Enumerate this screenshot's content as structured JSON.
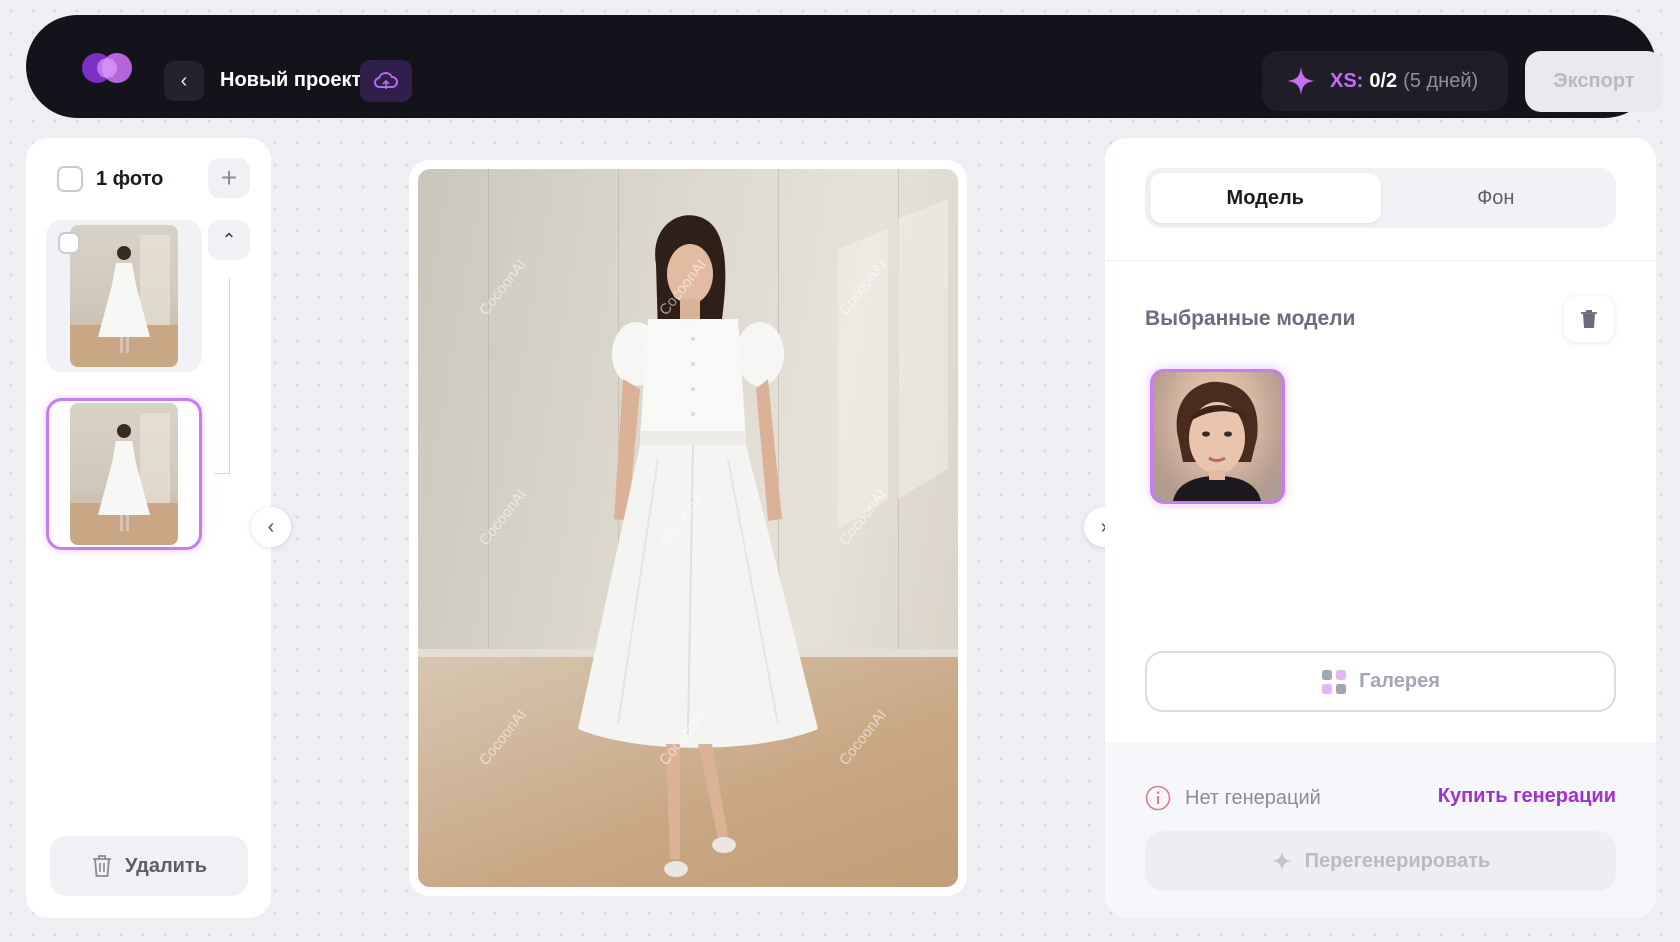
{
  "header": {
    "back_label": "‹",
    "project_title": "Новый проект",
    "credits": {
      "tier": "XS:",
      "count": "0/2",
      "days": "(5 дней)"
    },
    "export_label": "Экспорт"
  },
  "left_panel": {
    "count_label": "1 фото",
    "add_label": "+",
    "collapse_label": "⌃",
    "delete_label": "Удалить"
  },
  "canvas": {
    "prev_label": "‹",
    "next_label": "›",
    "watermark": "CocoonAI"
  },
  "right_panel": {
    "tabs": [
      {
        "label": "Модель",
        "active": true
      },
      {
        "label": "Фон",
        "active": false
      }
    ],
    "section_title": "Выбранные модели",
    "gallery_label": "Галерея",
    "no_generations": "Нет генераций",
    "buy_label": "Купить генерации",
    "regenerate_label": "Перегенерировать"
  },
  "colors": {
    "accent": "#c87bf2",
    "link": "#a22fd1",
    "topbar": "#14131b"
  },
  "icons": [
    "logo-icon",
    "cloud-icon",
    "sparkle-icon",
    "plus-icon",
    "chevron-up-icon",
    "trash-icon",
    "chevron-left-icon",
    "chevron-right-icon",
    "grid-icon",
    "info-icon"
  ]
}
